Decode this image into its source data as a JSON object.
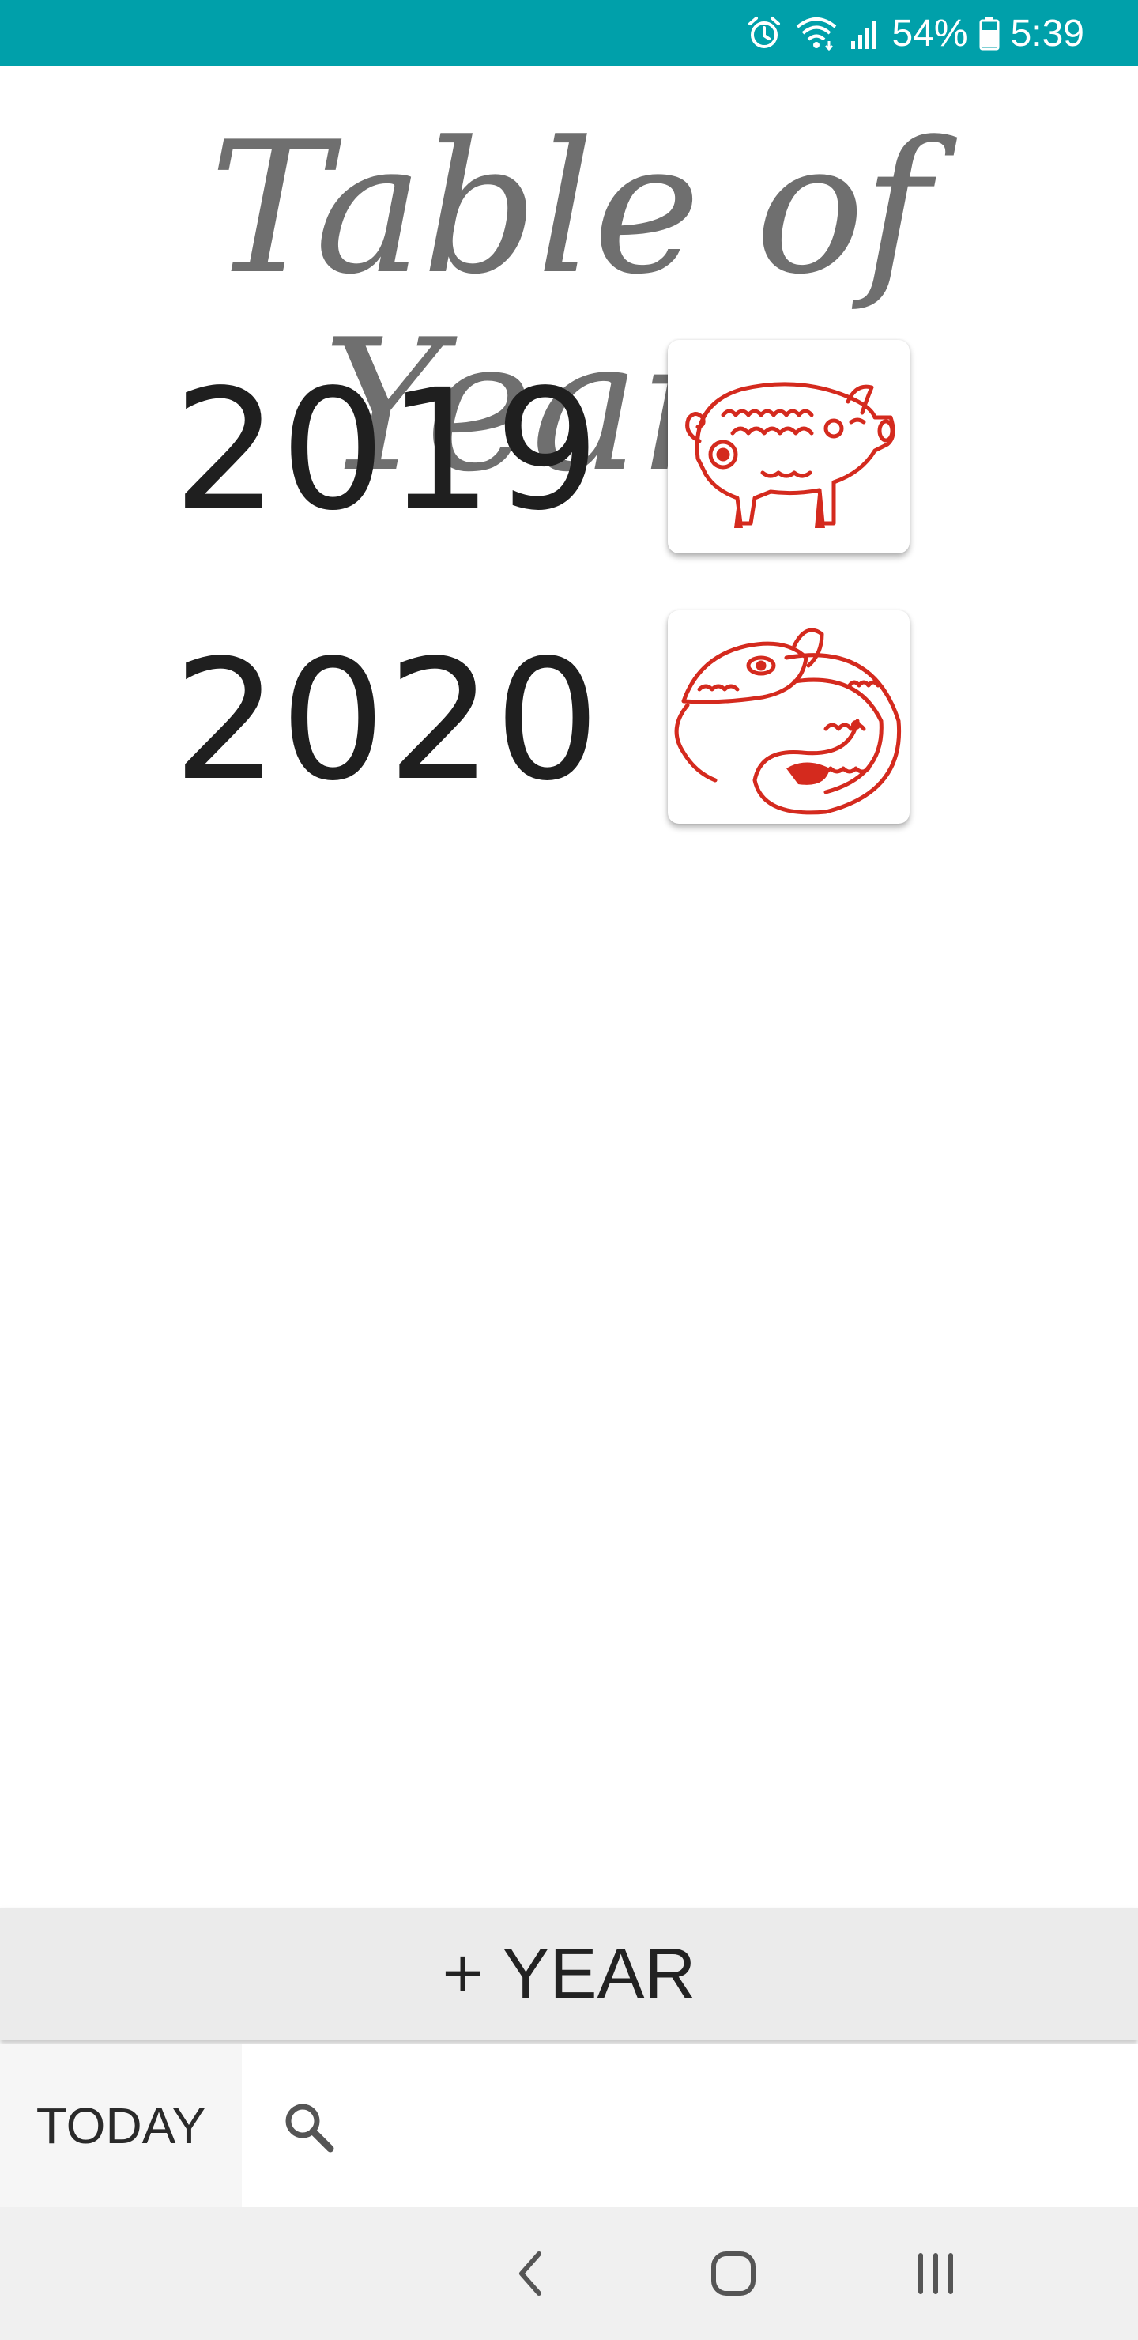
{
  "status_bar": {
    "battery": "54%",
    "time": "5:39",
    "background_color": "#00a0aa",
    "icons": [
      "alarm-icon",
      "wifi-icon",
      "signal-icon",
      "battery-icon"
    ]
  },
  "title": "Table of Years",
  "years": [
    {
      "year": "2019",
      "zodiac_icon": "pig-papercut-icon"
    },
    {
      "year": "2020",
      "zodiac_icon": "rat-papercut-icon"
    }
  ],
  "add_year_button": {
    "label": "+ YEAR"
  },
  "bottom_bar": {
    "today_label": "TODAY",
    "search_icon": "search-icon"
  },
  "nav": {
    "back_icon": "back-chevron-icon",
    "home_icon": "home-icon",
    "recents_icon": "recents-icon"
  },
  "colors": {
    "accent": "#00a0aa",
    "zodiac_red": "#d42a1e",
    "title_gray": "#6f6f6f"
  }
}
